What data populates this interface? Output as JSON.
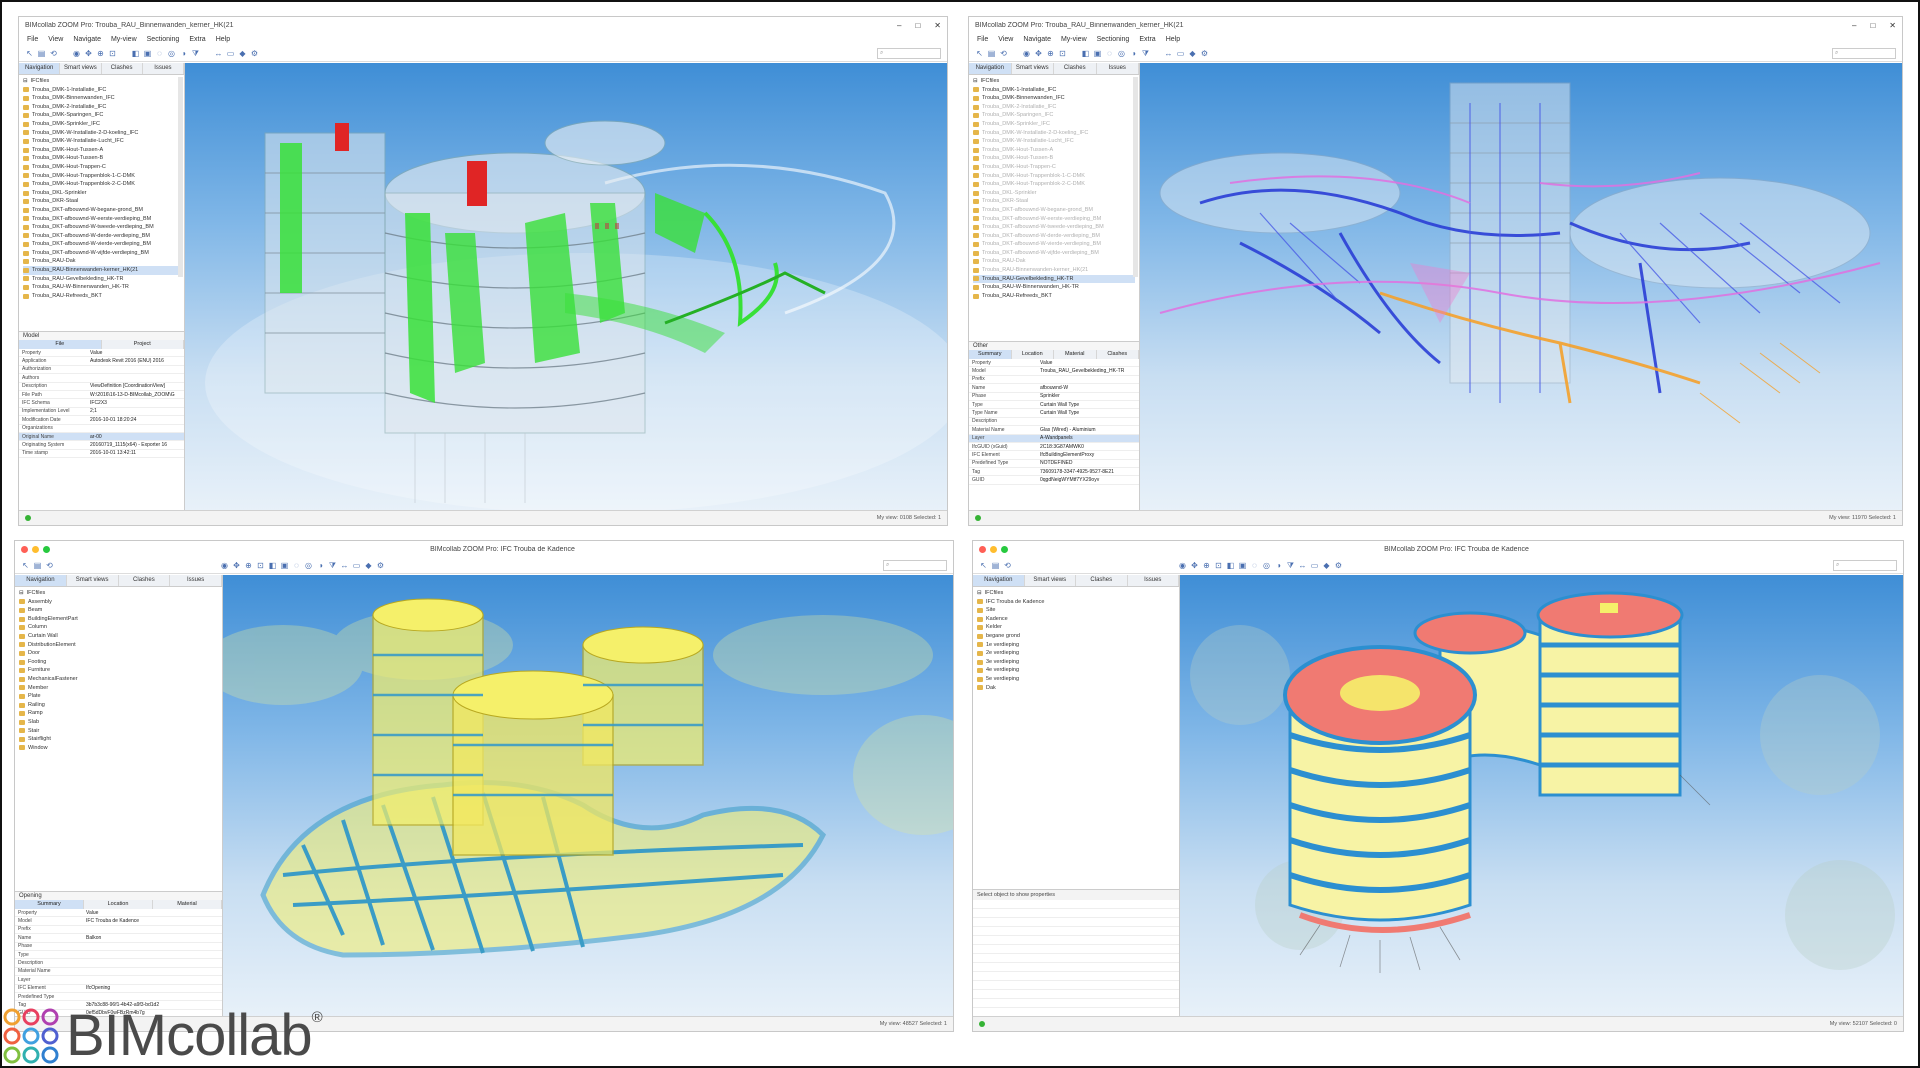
{
  "windows": [
    {
      "title": "BIMcollab ZOOM Pro: Trouba_RAU_Binnenwanden_kerner_HK(21",
      "menu": [
        "File",
        "View",
        "Navigate",
        "My-view",
        "Sectioning",
        "Extra",
        "Help"
      ],
      "tabs": [
        "Navigation",
        "Smart views",
        "Clashes",
        "Issues"
      ],
      "tree_root": "IFCfiles",
      "tree_items": [
        "Trouba_DMK-1-Installatie_IFC",
        "Trouba_DMK-Binnenwanden_IFC",
        "Trouba_DMK-2-Installatie_IFC",
        "Trouba_DMK-Sparingen_IFC",
        "Trouba_DMK-Sprinkler_IFC",
        "Trouba_DMK-W-Installatie-2-D-koeling_IFC",
        "Trouba_DMK-W-Installatie-Lucht_IFC",
        "Trouba_DMK-Hout-Tussen-A",
        "Trouba_DMK-Hout-Tussen-B",
        "Trouba_DMK-Hout-Trappen-C",
        "Trouba_DMK-Hout-Trappenblok-1-C-DMK",
        "Trouba_DMK-Hout-Trappenblok-2-C-DMK",
        "Trouba_DKL-Sprinkler",
        "Trouba_DKR-Staal",
        "Trouba_DKT-afbouwnd-W-begane-grond_BM",
        "Trouba_DKT-afbouwnd-W-eerste-verdieping_BM",
        "Trouba_DKT-afbouwnd-W-tweede-verdieping_BM",
        "Trouba_DKT-afbouwnd-W-derde-verdieping_BM",
        "Trouba_DKT-afbouwnd-W-vierde-verdieping_BM",
        "Trouba_DKT-afbouwnd-W-vijfde-verdieping_BM",
        "Trouba_RAU-Dak",
        "Trouba_RAU-Binnenwanden-kerner_HK(21",
        "Trouba_RAU-Gevelbekleding_HK-TR",
        "Trouba_RAU-W-Binnenwanden_HK-TR",
        "Trouba_RAU-Refreeds_BKT"
      ],
      "props_title": "Model",
      "props_tabs": [
        "File",
        "Project"
      ],
      "props_columns": [
        "Property",
        "Value"
      ],
      "props_rows": [
        [
          "Application",
          "Autodesk Revit 2016 (ENU) 2016"
        ],
        [
          "Authorization",
          ""
        ],
        [
          "Authors",
          ""
        ],
        [
          "Description",
          "ViewDefinition [CoordinationView]"
        ],
        [
          "File Path",
          "W:\\2016\\16-13-D-BIMcollab_ZOOM\\G"
        ],
        [
          "IFC Schema",
          "IFC2X3"
        ],
        [
          "Implementation Level",
          "2;1"
        ],
        [
          "Modification Date",
          "2016-10-01 18:20:24"
        ],
        [
          "Organizations",
          ""
        ],
        [
          "Original Name",
          "ar-00"
        ],
        [
          "Originating System",
          "20160719_1115(x64) - Exporter 16"
        ],
        [
          "Time stamp",
          "2016-10-01 13:42:11"
        ]
      ],
      "status": "My view: 0108  Selected: 1"
    },
    {
      "title": "BIMcollab ZOOM Pro: Trouba_RAU_Binnenwanden_kerner_HK(21",
      "menu": [
        "File",
        "View",
        "Navigate",
        "My-view",
        "Sectioning",
        "Extra",
        "Help"
      ],
      "tabs": [
        "Navigation",
        "Smart views",
        "Clashes",
        "Issues"
      ],
      "tree_root": "IFCfiles",
      "tree_items": [
        "Trouba_DMK-1-Installatie_IFC",
        "Trouba_DMK-Binnenwanden_IFC",
        "Trouba_DMK-2-Installatie_IFC",
        "Trouba_DMK-Sparingen_IFC",
        "Trouba_DMK-Sprinkler_IFC",
        "Trouba_DMK-W-Installatie-2-D-koeling_IFC",
        "Trouba_DMK-W-Installatie-Lucht_IFC",
        "Trouba_DMK-Hout-Tussen-A",
        "Trouba_DMK-Hout-Tussen-B",
        "Trouba_DMK-Hout-Trappen-C",
        "Trouba_DMK-Hout-Trappenblok-1-C-DMK",
        "Trouba_DMK-Hout-Trappenblok-2-C-DMK",
        "Trouba_DKL-Sprinkler",
        "Trouba_DKR-Staal",
        "Trouba_DKT-afbouwnd-W-begane-grond_BM",
        "Trouba_DKT-afbouwnd-W-eerste-verdieping_BM",
        "Trouba_DKT-afbouwnd-W-tweede-verdieping_BM",
        "Trouba_DKT-afbouwnd-W-derde-verdieping_BM",
        "Trouba_DKT-afbouwnd-W-vierde-verdieping_BM",
        "Trouba_DKT-afbouwnd-W-vijfde-verdieping_BM",
        "Trouba_RAU-Dak",
        "Trouba_RAU-Binnenwanden-kerner_HK(21",
        "Trouba_RAU-Gevelbekleding_HK-TR",
        "Trouba_RAU-W-Binnenwanden_HK-TR",
        "Trouba_RAU-Refreeds_BKT"
      ],
      "props_title": "Other",
      "props_tabs": [
        "Summary",
        "Location",
        "Material",
        "Clashes"
      ],
      "props_columns": [
        "Property",
        "Value"
      ],
      "props_rows": [
        [
          "Model",
          "Trouba_RAU_Gevelbekleding_HK-TR"
        ],
        [
          "Prefix",
          ""
        ],
        [
          "Name",
          "afbouwnd-W"
        ],
        [
          "Phase",
          "Sprinkler"
        ],
        [
          "Type",
          "Curtain Wall Type"
        ],
        [
          "Type Name",
          "Curtain Wall Type"
        ],
        [
          "Description",
          ""
        ],
        [
          "Material Name",
          "Glas (Wired) - Aluminium"
        ],
        [
          "Layer",
          "A-Wandpanels"
        ],
        [
          "IfcGUID (xGuid)",
          "2C18:3G87AMWK0"
        ],
        [
          "IFC Element",
          "IfcBuildingElementProxy"
        ],
        [
          "Predefined Type",
          "NOTDEFINED"
        ],
        [
          "Tag",
          "73609178-3347-4925-9527-8E21"
        ],
        [
          "GUID",
          "0qgdNeigWYMtf7YX29oyv"
        ]
      ],
      "status": "My view: 11970  Selected: 1"
    },
    {
      "title": "BIMcollab ZOOM Pro: IFC Trouba de Kadence",
      "tabs": [
        "Navigation",
        "Smart views",
        "Clashes",
        "Issues"
      ],
      "tree_root": "IFCfiles",
      "tree_items": [
        "Assembly",
        "Beam",
        "BuildingElementPart",
        "Column",
        "Curtain Wall",
        "DistributionElement",
        "Door",
        "Footing",
        "Furniture",
        "MechanicalFastener",
        "Member",
        "Plate",
        "Railing",
        "Ramp",
        "Slab",
        "Stair",
        "Stairflight",
        "Window"
      ],
      "props_title": "Opening",
      "props_tabs": [
        "Summary",
        "Location",
        "Material"
      ],
      "props_columns": [
        "Property",
        "Value"
      ],
      "props_rows": [
        [
          "Model",
          "IFC Trouba de Kadence"
        ],
        [
          "Prefix",
          ""
        ],
        [
          "Name",
          "Balkon"
        ],
        [
          "Phase",
          ""
        ],
        [
          "Type",
          ""
        ],
        [
          "Description",
          ""
        ],
        [
          "Material Name",
          ""
        ],
        [
          "Layer",
          ""
        ],
        [
          "IFC Element",
          "IfcOpening"
        ],
        [
          "Predefined Type",
          ""
        ],
        [
          "Tag",
          "3b7b3c88-96f1-4b42-a9f3-bd1d2"
        ],
        [
          "GUID",
          "0ef5dDbvF0wFBzRm4b7g"
        ]
      ],
      "status": "My view: 48527  Selected: 1"
    },
    {
      "title": "BIMcollab ZOOM Pro: IFC Trouba de Kadence",
      "tabs": [
        "Navigation",
        "Smart views",
        "Clashes",
        "Issues"
      ],
      "tree_root": "IFCfiles",
      "tree_items": [
        "IFC Trouba de Kadence",
        "Site",
        "Kadence",
        "Kelder",
        "begane grond",
        "1e verdieping",
        "2e verdieping",
        "3e verdieping",
        "4e verdieping",
        "5e verdieping",
        "Dak"
      ],
      "props_title": "Select object to show properties",
      "status": "My view: 52107  Selected: 0"
    }
  ],
  "logo": {
    "name": "BIMcollab",
    "mark": "®"
  },
  "colors": {
    "sky_top": "#3f8ed6",
    "highlight_green": "#38e038",
    "highlight_red": "#e02525",
    "pipe_blue": "#2b3fd6",
    "pipe_magenta": "#e070e0",
    "pipe_orange": "#f4a12c",
    "structure_yellow": "#f5f06a",
    "structure_steel": "#3a9cc6",
    "roof_salmon": "#f07a72",
    "selection_blue": "#cfe0f5"
  }
}
